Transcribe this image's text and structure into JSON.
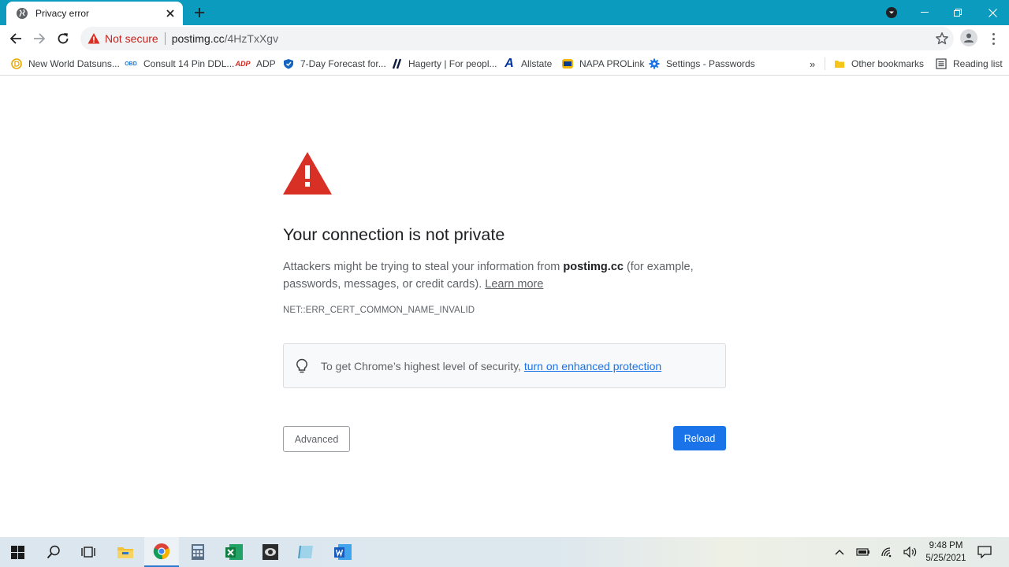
{
  "browser": {
    "tab_title": "Privacy error",
    "not_secure_label": "Not secure",
    "url_host": "postimg.cc",
    "url_path": "/4HzTxXgv"
  },
  "bookmarks": {
    "items": [
      {
        "label": "New World Datsuns..."
      },
      {
        "label": "Consult 14 Pin DDL..."
      },
      {
        "label": "ADP"
      },
      {
        "label": "7-Day Forecast for..."
      },
      {
        "label": "Hagerty | For peopl..."
      },
      {
        "label": "Allstate"
      },
      {
        "label": "NAPA PROLink"
      },
      {
        "label": "Settings - Passwords"
      }
    ],
    "overflow_label": "»",
    "other_bookmarks": "Other bookmarks",
    "reading_list": "Reading list"
  },
  "page": {
    "heading": "Your connection is not private",
    "desc_part1": "Attackers might be trying to steal your information from ",
    "desc_host": "postimg.cc",
    "desc_part2": " (for example, passwords, messages, or credit cards). ",
    "learn_more": "Learn more",
    "error_code": "NET::ERR_CERT_COMMON_NAME_INVALID",
    "enhanced_text": "To get Chrome’s highest level of security, ",
    "enhanced_link": "turn on enhanced protection",
    "advanced_button": "Advanced",
    "reload_button": "Reload"
  },
  "taskbar": {
    "time": "9:48 PM",
    "date": "5/25/2021"
  },
  "colors": {
    "titlebar": "#0a9bbf",
    "warning_red": "#d93025",
    "link_blue": "#1a73e8",
    "reload_blue": "#1a73e8"
  }
}
